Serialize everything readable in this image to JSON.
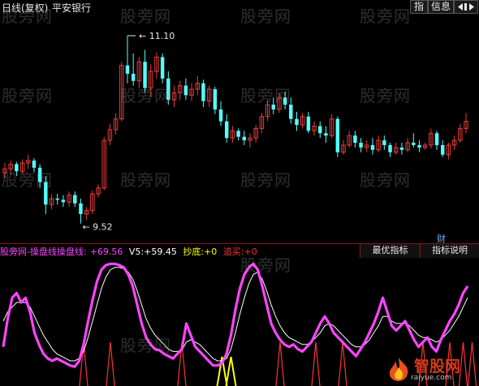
{
  "header": {
    "period": "日线(复权)",
    "stock_name": "平安银行",
    "btn_index": "指",
    "btn_info": "信息",
    "btn_back": "◀▶"
  },
  "main_chart": {
    "high_label": "11.10",
    "low_label": "9.52",
    "cai_label": "财",
    "up_color": "#e83c3c",
    "down_color": "#54ffff",
    "candles": [
      [
        9.95,
        10.03,
        9.9,
        9.98
      ],
      [
        9.98,
        10.05,
        9.93,
        10.02
      ],
      [
        10.02,
        10.04,
        9.92,
        9.96
      ],
      [
        9.96,
        10.06,
        9.94,
        10.03
      ],
      [
        10.03,
        10.1,
        9.98,
        10.05
      ],
      [
        10.05,
        10.07,
        9.95,
        9.99
      ],
      [
        9.99,
        10.02,
        9.82,
        9.87
      ],
      [
        9.87,
        9.92,
        9.6,
        9.68
      ],
      [
        9.68,
        9.77,
        9.64,
        9.73
      ],
      [
        9.73,
        9.77,
        9.68,
        9.72
      ],
      [
        9.72,
        9.76,
        9.66,
        9.7
      ],
      [
        9.7,
        9.79,
        9.66,
        9.76
      ],
      [
        9.76,
        9.79,
        9.66,
        9.69
      ],
      [
        9.69,
        9.73,
        9.52,
        9.6
      ],
      [
        9.6,
        9.66,
        9.55,
        9.63
      ],
      [
        9.63,
        9.8,
        9.6,
        9.77
      ],
      [
        9.77,
        9.85,
        9.74,
        9.82
      ],
      [
        9.82,
        10.25,
        9.8,
        10.22
      ],
      [
        10.22,
        10.36,
        10.18,
        10.31
      ],
      [
        10.31,
        10.45,
        10.27,
        10.4
      ],
      [
        10.4,
        10.88,
        10.38,
        10.85
      ],
      [
        10.85,
        11.1,
        10.7,
        10.78
      ],
      [
        10.78,
        10.95,
        10.68,
        10.72
      ],
      [
        10.72,
        10.92,
        10.66,
        10.88
      ],
      [
        10.88,
        10.98,
        10.62,
        10.66
      ],
      [
        10.66,
        10.86,
        10.58,
        10.8
      ],
      [
        10.8,
        10.96,
        10.74,
        10.92
      ],
      [
        10.92,
        10.95,
        10.7,
        10.74
      ],
      [
        10.74,
        10.8,
        10.52,
        10.56
      ],
      [
        10.56,
        10.68,
        10.5,
        10.62
      ],
      [
        10.62,
        10.72,
        10.56,
        10.68
      ],
      [
        10.68,
        10.74,
        10.56,
        10.6
      ],
      [
        10.6,
        10.7,
        10.55,
        10.65
      ],
      [
        10.65,
        10.76,
        10.6,
        10.7
      ],
      [
        10.7,
        10.73,
        10.5,
        10.55
      ],
      [
        10.55,
        10.68,
        10.5,
        10.65
      ],
      [
        10.65,
        10.67,
        10.44,
        10.48
      ],
      [
        10.48,
        10.55,
        10.34,
        10.38
      ],
      [
        10.38,
        10.44,
        10.2,
        10.24
      ],
      [
        10.24,
        10.34,
        10.2,
        10.3
      ],
      [
        10.3,
        10.32,
        10.22,
        10.25
      ],
      [
        10.25,
        10.3,
        10.18,
        10.22
      ],
      [
        10.22,
        10.28,
        10.16,
        10.24
      ],
      [
        10.24,
        10.35,
        10.2,
        10.32
      ],
      [
        10.32,
        10.45,
        10.28,
        10.42
      ],
      [
        10.42,
        10.56,
        10.38,
        10.52
      ],
      [
        10.52,
        10.58,
        10.44,
        10.48
      ],
      [
        10.48,
        10.62,
        10.45,
        10.58
      ],
      [
        10.58,
        10.63,
        10.48,
        10.52
      ],
      [
        10.52,
        10.58,
        10.36,
        10.4
      ],
      [
        10.4,
        10.46,
        10.3,
        10.35
      ],
      [
        10.35,
        10.45,
        10.32,
        10.42
      ],
      [
        10.42,
        10.46,
        10.28,
        10.3
      ],
      [
        10.3,
        10.38,
        10.26,
        10.34
      ],
      [
        10.34,
        10.38,
        10.24,
        10.28
      ],
      [
        10.28,
        10.34,
        10.2,
        10.26
      ],
      [
        10.26,
        10.44,
        10.24,
        10.4
      ],
      [
        10.4,
        10.42,
        10.08,
        10.12
      ],
      [
        10.12,
        10.22,
        10.1,
        10.18
      ],
      [
        10.18,
        10.3,
        10.16,
        10.26
      ],
      [
        10.26,
        10.3,
        10.16,
        10.2
      ],
      [
        10.2,
        10.24,
        10.12,
        10.16
      ],
      [
        10.16,
        10.22,
        10.12,
        10.18
      ],
      [
        10.18,
        10.24,
        10.1,
        10.14
      ],
      [
        10.14,
        10.26,
        10.12,
        10.22
      ],
      [
        10.22,
        10.26,
        10.14,
        10.18
      ],
      [
        10.18,
        10.2,
        10.08,
        10.12
      ],
      [
        10.12,
        10.2,
        10.1,
        10.16
      ],
      [
        10.16,
        10.2,
        10.1,
        10.14
      ],
      [
        10.14,
        10.24,
        10.12,
        10.2
      ],
      [
        10.2,
        10.28,
        10.16,
        10.18
      ],
      [
        10.18,
        10.22,
        10.12,
        10.16
      ],
      [
        10.16,
        10.2,
        10.14,
        10.18
      ],
      [
        10.18,
        10.32,
        10.15,
        10.28
      ],
      [
        10.28,
        10.3,
        10.14,
        10.18
      ],
      [
        10.18,
        10.22,
        10.08,
        10.1
      ],
      [
        10.1,
        10.2,
        10.06,
        10.18
      ],
      [
        10.18,
        10.26,
        10.14,
        10.22
      ],
      [
        10.22,
        10.36,
        10.2,
        10.32
      ],
      [
        10.32,
        10.45,
        10.28,
        10.38
      ]
    ]
  },
  "indicator": {
    "name": "股旁网-操盘线",
    "line1_label": "操盘线:",
    "line1_value": "+69.56",
    "line2_label": "V5:",
    "line2_value": "+59.45",
    "buy_label": "抄底:",
    "buy_value": "+0",
    "chase_label": "追买:",
    "chase_value": "+0",
    "tab_best": "最优指标",
    "tab_help": "指标说明",
    "line1_color": "#ff44ff",
    "line2_color": "#ffffff",
    "buy_color": "#ffff00",
    "chase_color": "#ff3333",
    "line1": [
      28,
      52,
      70,
      74,
      66,
      70,
      58,
      40,
      30,
      22,
      18,
      16,
      18,
      16,
      14,
      12,
      11,
      16,
      30,
      50,
      68,
      84,
      94,
      98,
      99,
      99,
      98,
      96,
      90,
      80,
      64,
      48,
      36,
      30,
      26,
      25,
      22,
      20,
      18,
      22,
      26,
      48,
      38,
      28,
      24,
      20,
      16,
      12,
      12,
      14,
      22,
      38,
      60,
      78,
      90,
      96,
      99,
      94,
      80,
      64,
      48,
      40,
      34,
      30,
      28,
      30,
      26,
      24,
      28,
      32,
      40,
      48,
      54,
      48,
      40,
      36,
      32,
      28,
      24,
      20,
      26,
      32,
      40,
      48,
      58,
      70,
      58,
      46,
      42,
      46,
      50,
      42,
      34,
      28,
      32,
      36,
      28,
      24,
      34,
      42,
      50,
      56,
      64,
      74,
      80
    ],
    "line2": [
      50,
      58,
      62,
      66,
      66,
      66,
      62,
      54,
      46,
      38,
      32,
      26,
      22,
      20,
      18,
      16,
      16,
      18,
      24,
      36,
      50,
      64,
      78,
      88,
      94,
      96,
      96,
      95,
      92,
      86,
      76,
      64,
      52,
      44,
      38,
      34,
      30,
      26,
      24,
      24,
      25,
      32,
      34,
      32,
      30,
      26,
      22,
      18,
      16,
      16,
      18,
      26,
      40,
      56,
      70,
      82,
      90,
      92,
      86,
      76,
      64,
      54,
      46,
      40,
      36,
      34,
      32,
      30,
      30,
      32,
      36,
      40,
      46,
      48,
      46,
      42,
      38,
      34,
      30,
      28,
      28,
      30,
      34,
      40,
      46,
      54,
      54,
      50,
      48,
      48,
      48,
      46,
      42,
      38,
      36,
      36,
      34,
      32,
      34,
      38,
      42,
      48,
      54,
      62,
      70
    ],
    "chase_spikes": [
      18,
      24,
      40,
      62,
      70,
      76,
      94,
      100,
      103,
      105,
      111,
      115
    ],
    "buy_spikes": [
      49,
      51
    ]
  },
  "watermarks": [
    "股旁网",
    "股旁网",
    "股旁网",
    "股旁网",
    "股旁网",
    "股旁网",
    "股旁网",
    "股旁网",
    "股旁网",
    "股旁网",
    "股旁网",
    "股旁网",
    "股旁网",
    "股旁网"
  ],
  "logo": {
    "main": "智股网",
    "sub": "raiyue.com"
  }
}
